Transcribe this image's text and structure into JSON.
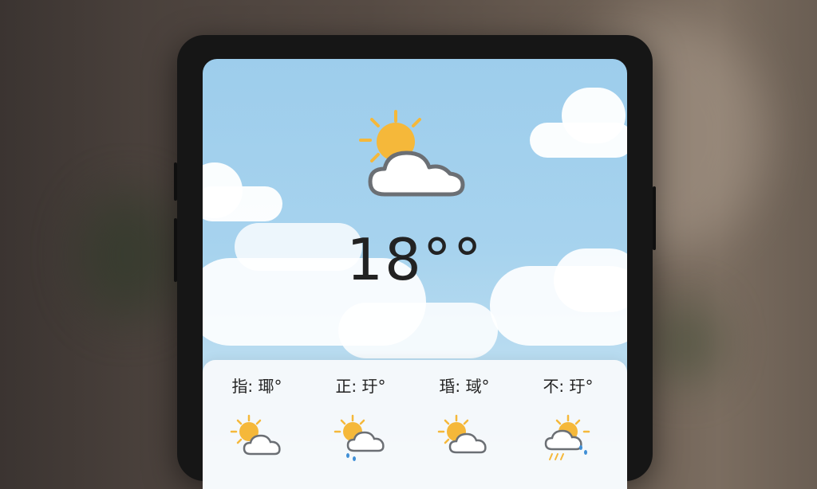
{
  "weather": {
    "temperature": "18°°",
    "current_condition_icon": "partly-cloudy-icon"
  },
  "forecast": [
    {
      "label": "指: 瑘°",
      "icon": "partly-cloudy-icon"
    },
    {
      "label": "正: 玗°",
      "icon": "partly-cloudy-rain-icon"
    },
    {
      "label": "琘: 琙°",
      "icon": "partly-cloudy-icon"
    },
    {
      "label": "不: 玗°",
      "icon": "partly-cloudy-rain-icon"
    }
  ],
  "colors": {
    "sky_top": "#9dcdec",
    "sun": "#f5b83a",
    "cloud_outline": "#6b6f74",
    "rain": "#3f8fd6"
  }
}
